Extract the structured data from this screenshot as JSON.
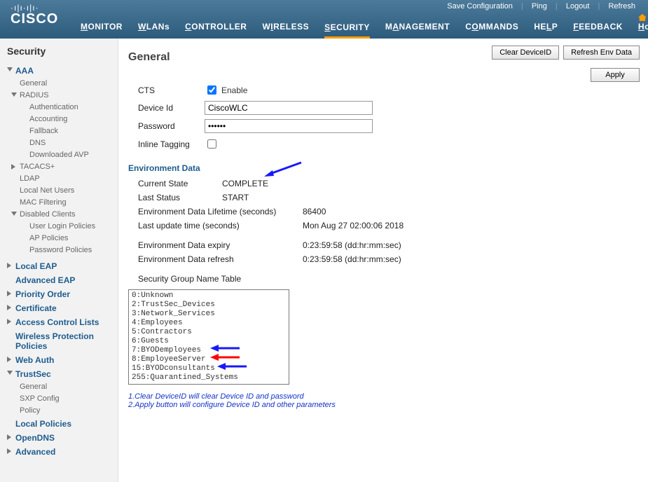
{
  "top_links": {
    "save": "Save Configuration",
    "ping": "Ping",
    "logout": "Logout",
    "refresh": "Refresh"
  },
  "nav": {
    "monitor": "MONITOR",
    "wlans": "WLANs",
    "controller": "CONTROLLER",
    "wireless": "WIRELESS",
    "security": "SECURITY",
    "management": "MANAGEMENT",
    "commands": "COMMANDS",
    "help": "HELP",
    "feedback": "FEEDBACK",
    "home": "Home"
  },
  "sidebar": {
    "title": "Security",
    "aaa": "AAA",
    "aaa_general": "General",
    "radius": "RADIUS",
    "radius_auth": "Authentication",
    "radius_acct": "Accounting",
    "radius_fallback": "Fallback",
    "radius_dns": "DNS",
    "radius_avp": "Downloaded AVP",
    "tacacs": "TACACS+",
    "ldap": "LDAP",
    "localnet": "Local Net Users",
    "macfilter": "MAC Filtering",
    "disabled": "Disabled Clients",
    "userlogin": "User Login Policies",
    "appolicies": "AP Policies",
    "pwdpolicies": "Password Policies",
    "localeap": "Local EAP",
    "adveap": "Advanced EAP",
    "priority": "Priority Order",
    "cert": "Certificate",
    "acl": "Access Control Lists",
    "wpp": "Wireless Protection Policies",
    "webauth": "Web Auth",
    "trustsec": "TrustSec",
    "ts_general": "General",
    "ts_sxp": "SXP Config",
    "ts_policy": "Policy",
    "localpol": "Local Policies",
    "opendns": "OpenDNS",
    "advanced": "Advanced"
  },
  "buttons": {
    "clear": "Clear DeviceID",
    "refresh_env": "Refresh Env Data",
    "apply": "Apply"
  },
  "page_title": "General",
  "form": {
    "cts_lbl": "CTS",
    "cts_enable": "Enable",
    "device_id_lbl": "Device Id",
    "device_id_val": "CiscoWLC",
    "password_lbl": "Password",
    "password_val": "••••••",
    "inline_tag_lbl": "Inline Tagging"
  },
  "env": {
    "header": "Environment Data",
    "state_lbl": "Current State",
    "state_val": "COMPLETE",
    "status_lbl": "Last Status",
    "status_val": "START",
    "lifetime_lbl": "Environment Data Lifetime (seconds)",
    "lifetime_val": "86400",
    "update_lbl": "Last update time (seconds)",
    "update_val": "Mon Aug 27 02:00:06 2018",
    "expiry_lbl": "Environment Data expiry",
    "expiry_val": "0:23:59:58 (dd:hr:mm:sec)",
    "refresh_lbl": "Environment Data refresh",
    "refresh_val": "0:23:59:58 (dd:hr:mm:sec)",
    "sg_lbl": "Security Group Name Table",
    "sg_rows": [
      "0:Unknown",
      "2:TrustSec_Devices",
      "3:Network_Services",
      "4:Employees",
      "5:Contractors",
      "6:Guests",
      "7:BYODemployees",
      "8:EmployeeServer",
      "15:BYODconsultants",
      "255:Quarantined_Systems"
    ]
  },
  "notes": {
    "n1": "1.Clear DeviceID will clear Device ID and password",
    "n2": "2.Apply button will configure Device ID and other parameters"
  }
}
